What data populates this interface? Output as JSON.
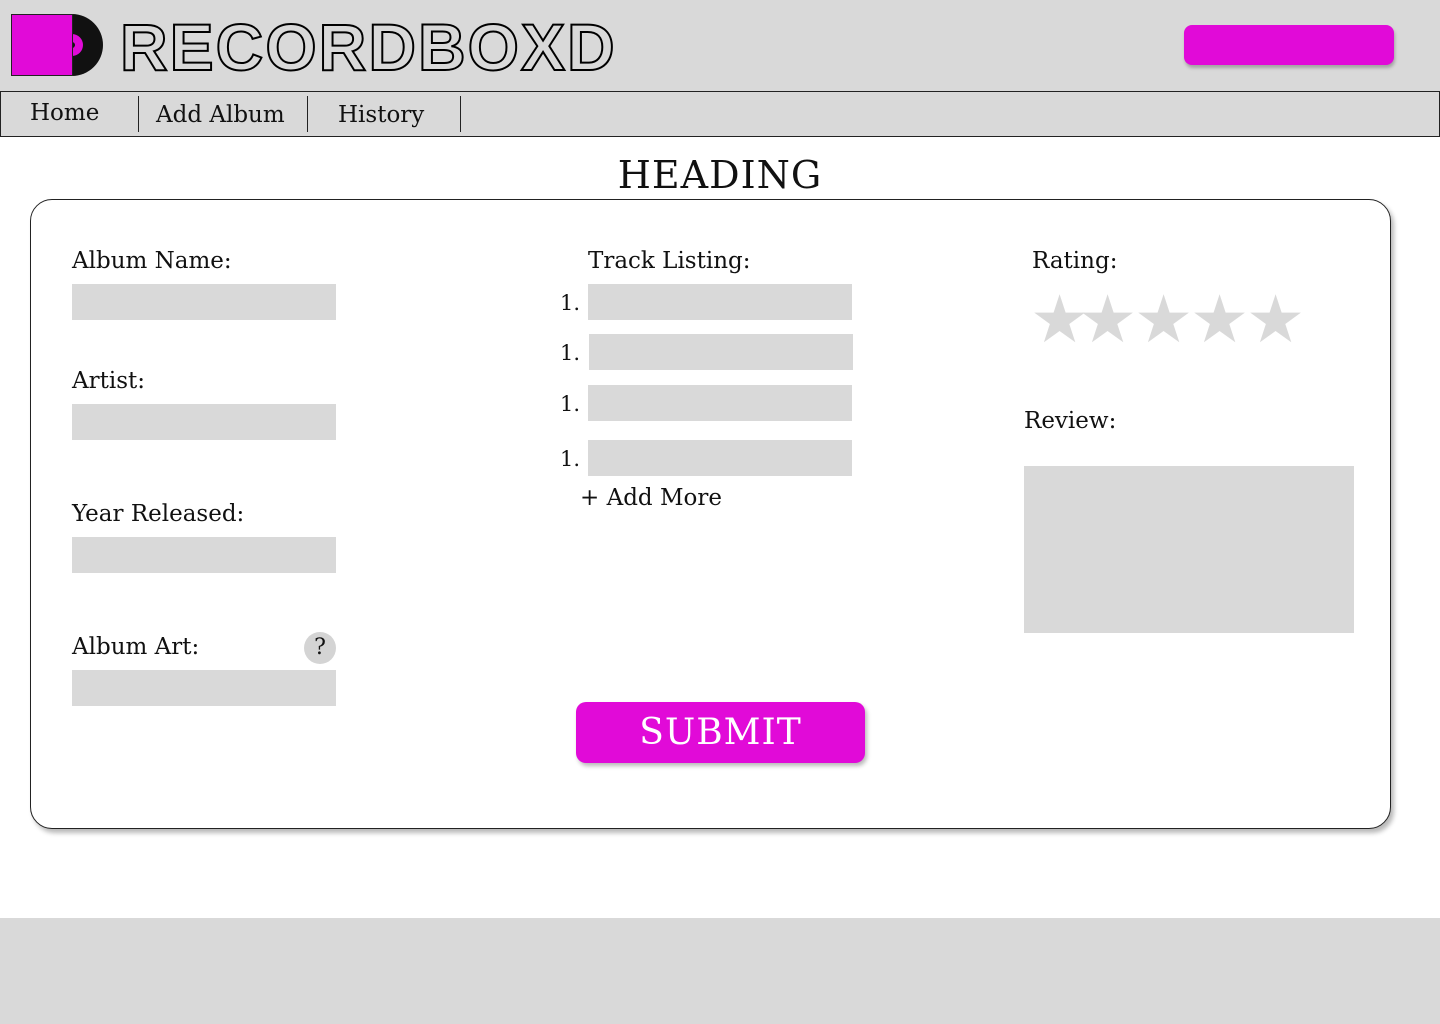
{
  "brand": {
    "name": "RECORDBOXD",
    "accent": "#e10ad8",
    "logo_icon": "vinyl-record-icon"
  },
  "nav": {
    "items": [
      {
        "label": "Home"
      },
      {
        "label": "Add Album"
      },
      {
        "label": "History"
      }
    ]
  },
  "page": {
    "heading": "HEADING"
  },
  "form": {
    "album_name_label": "Album Name:",
    "artist_label": "Artist:",
    "year_label": "Year Released:",
    "album_art_label": "Album Art:",
    "help_glyph": "?",
    "tracks_label": "Track Listing:",
    "track_numbers": [
      "1.",
      "1.",
      "1.",
      "1."
    ],
    "add_more_label": "+ Add More",
    "rating_label": "Rating:",
    "rating_value": 0,
    "rating_max": 5,
    "review_label": "Review:",
    "submit_label": "SUBMIT"
  }
}
